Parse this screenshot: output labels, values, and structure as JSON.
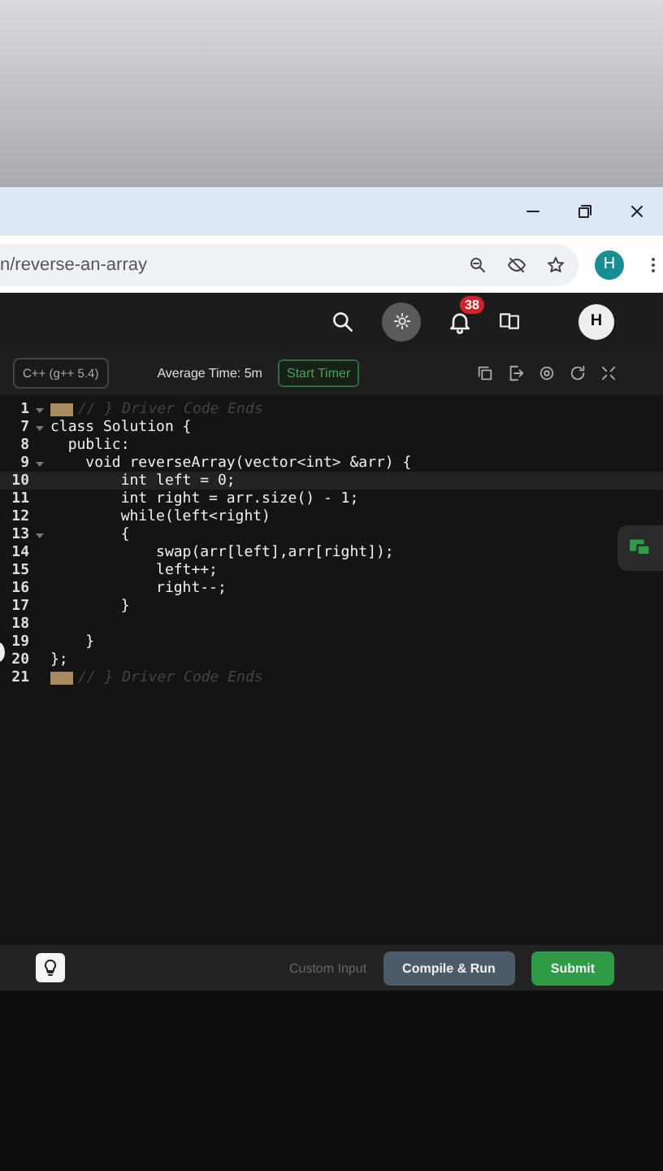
{
  "browser": {
    "url": "n/reverse-an-array",
    "profile_initial": "H"
  },
  "site_header": {
    "notification_count": "38",
    "avatar_initial": "H"
  },
  "toolbar": {
    "language": "C++ (g++ 5.4)",
    "average_time": "Average Time: 5m",
    "timer_button": "Start Timer"
  },
  "editor": {
    "lines": [
      {
        "number": "1",
        "kind": "folded",
        "text": "// } Driver Code Ends",
        "foldable": true,
        "selected": false
      },
      {
        "number": "7",
        "kind": "code",
        "text": "class Solution {",
        "foldable": true,
        "selected": false
      },
      {
        "number": "8",
        "kind": "code",
        "text": "  public:",
        "foldable": false,
        "selected": false
      },
      {
        "number": "9",
        "kind": "code",
        "text": "    void reverseArray(vector<int> &arr) {",
        "foldable": true,
        "selected": false
      },
      {
        "number": "10",
        "kind": "code",
        "text": "        int left = 0;",
        "foldable": false,
        "selected": true
      },
      {
        "number": "11",
        "kind": "code",
        "text": "        int right = arr.size() - 1;",
        "foldable": false,
        "selected": false
      },
      {
        "number": "12",
        "kind": "code",
        "text": "        while(left<right)",
        "foldable": false,
        "selected": false
      },
      {
        "number": "13",
        "kind": "code",
        "text": "        {",
        "foldable": true,
        "selected": false
      },
      {
        "number": "14",
        "kind": "code",
        "text": "            swap(arr[left],arr[right]);",
        "foldable": false,
        "selected": false
      },
      {
        "number": "15",
        "kind": "code",
        "text": "            left++;",
        "foldable": false,
        "selected": false
      },
      {
        "number": "16",
        "kind": "code",
        "text": "            right--;",
        "foldable": false,
        "selected": false
      },
      {
        "number": "17",
        "kind": "code",
        "text": "        }",
        "foldable": false,
        "selected": false
      },
      {
        "number": "18",
        "kind": "code",
        "foldable": false,
        "selected": false
      },
      {
        "number": "19",
        "kind": "code",
        "text": "    }",
        "foldable": false,
        "selected": false
      },
      {
        "number": "20",
        "kind": "code",
        "text": "};",
        "foldable": false,
        "selected": false
      },
      {
        "number": "21",
        "kind": "folded",
        "text": "// } Driver Code Ends",
        "foldable": false,
        "selected": false
      }
    ]
  },
  "footer": {
    "custom_input": "Custom Input",
    "buttons": [
      {
        "label": "Compile & Run",
        "kind": "secondary"
      },
      {
        "label": "Submit",
        "kind": "primary"
      }
    ]
  }
}
